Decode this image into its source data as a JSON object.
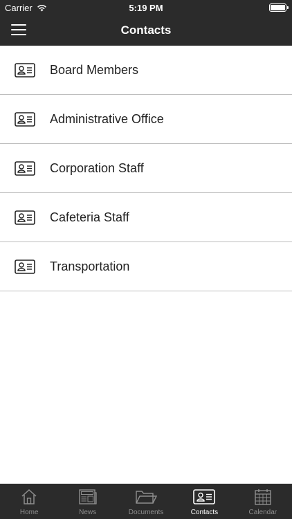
{
  "status_bar": {
    "carrier": "Carrier",
    "time": "5:19 PM"
  },
  "nav": {
    "title": "Contacts"
  },
  "contacts": [
    {
      "label": "Board Members",
      "icon": "contact-card-icon"
    },
    {
      "label": "Administrative Office",
      "icon": "contact-card-icon"
    },
    {
      "label": "Corporation Staff",
      "icon": "contact-card-icon"
    },
    {
      "label": "Cafeteria Staff",
      "icon": "contact-card-icon"
    },
    {
      "label": "Transportation",
      "icon": "contact-card-icon"
    }
  ],
  "tabs": [
    {
      "label": "Home",
      "icon": "home-icon",
      "active": false
    },
    {
      "label": "News",
      "icon": "newspaper-icon",
      "active": false
    },
    {
      "label": "Documents",
      "icon": "folder-icon",
      "active": false
    },
    {
      "label": "Contacts",
      "icon": "contact-card-icon",
      "active": true
    },
    {
      "label": "Calendar",
      "icon": "calendar-icon",
      "active": false
    }
  ],
  "colors": {
    "bar_bg": "#2b2b2b",
    "divider": "#bdbdbd",
    "tab_inactive": "#8e8e8e",
    "tab_active": "#ffffff"
  }
}
